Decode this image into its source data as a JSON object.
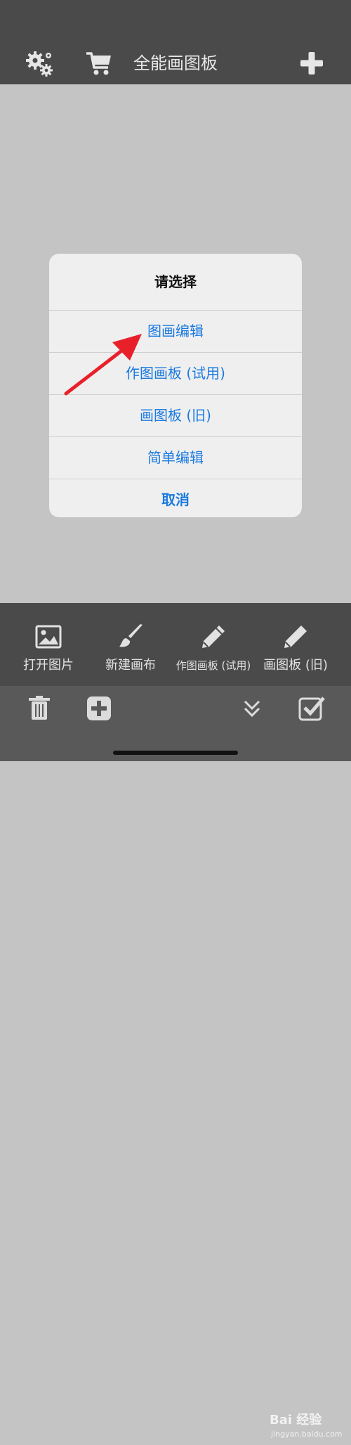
{
  "header": {
    "title": "全能画图板"
  },
  "dialog": {
    "title": "请选择",
    "options": [
      "图画编辑",
      "作图画板 (试用)",
      "画图板 (旧)",
      "简单编辑"
    ],
    "cancel": "取消"
  },
  "toolbar": {
    "items": [
      {
        "label": "打开图片",
        "icon": "image-icon"
      },
      {
        "label": "新建画布",
        "icon": "brush-icon"
      },
      {
        "label": "作图画板 (试用)",
        "icon": "pencil-icon"
      },
      {
        "label": "画图板 (旧)",
        "icon": "pencil-icon"
      }
    ]
  },
  "watermark": {
    "brand": "Bai 经验",
    "url": "jingyan.baidu.com"
  },
  "colors": {
    "bar": "#4a4a4a",
    "canvas": "#c4c4c4",
    "accent": "#1a7ae0",
    "arrow": "#e8202a"
  }
}
